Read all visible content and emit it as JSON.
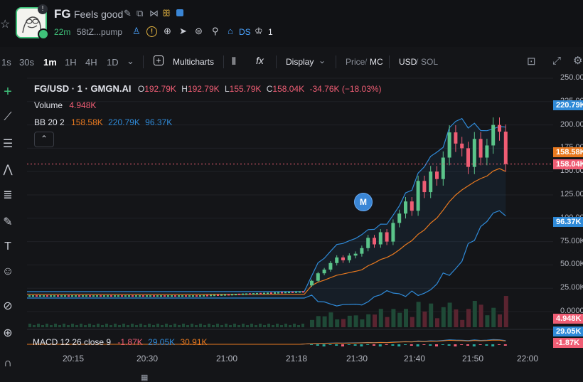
{
  "header": {
    "ticker": "FG",
    "tagline": "Feels good",
    "age": "22m",
    "address": "58tZ...pump",
    "badge": "!",
    "ds_label": "DS",
    "holders_count": "1",
    "icons": [
      "edit-icon",
      "copy-icon",
      "share-icon",
      "people-icon",
      "verified-icon",
      "user-icon",
      "warning-icon",
      "globe-icon",
      "telegram-icon",
      "list-icon",
      "search-icon",
      "dexscreener-icon",
      "crown-icon"
    ],
    "colors": {
      "accent_green": "#3fc27a",
      "accent_blue": "#3a86d6"
    }
  },
  "toolbar": {
    "timeframes": [
      "1s",
      "30s",
      "1m",
      "1H",
      "4H",
      "1D"
    ],
    "active_timeframe": "1m",
    "multicharts_label": "Multicharts",
    "display_label": "Display",
    "price_label": "Price",
    "mc_label": "MC",
    "usd_label": "USD",
    "sol_label": "SOL",
    "fx_label": "fx"
  },
  "chart_meta": {
    "symbol": "FG/USD · 1 · GMGN.AI",
    "open_label": "O",
    "open": "192.79K",
    "high_label": "H",
    "high": "192.79K",
    "low_label": "L",
    "low": "155.79K",
    "close_label": "C",
    "close": "158.04K",
    "change": "-34.76K (−18.03%)",
    "volume_label": "Volume",
    "volume": "4.948K",
    "bb_label": "BB 20 2",
    "bb_basis": "158.58K",
    "bb_upper": "220.79K",
    "bb_lower": "96.37K",
    "macd_label": "MACD 12 26 close 9",
    "macd_hist": "-1.87K",
    "macd_line": "29.05K",
    "macd_signal": "30.91K",
    "marker": "M",
    "price_tags": {
      "upper": "220.79K",
      "basis": "158.58K",
      "last": "158.04K",
      "lower": "96.37K",
      "volume": "4.948K",
      "macd_line": "29.05K",
      "macd_hist": "-1.87K"
    },
    "colors": {
      "up": "#5bc48a",
      "down": "#ef5d74",
      "bb_upper_lower": "#2f8ad8",
      "bb_basis": "#e8791f"
    }
  },
  "chart_data": {
    "type": "candlestick",
    "y_axis_ticks": [
      "250.00K",
      "225.00K",
      "200.00K",
      "175.00K",
      "150.00K",
      "125.00K",
      "100.00K",
      "75.00K",
      "50.00K",
      "25.00K",
      "0.0000"
    ],
    "x_axis_ticks": [
      "20:15",
      "20:30",
      "21:00",
      "21:18",
      "21:30",
      "21:40",
      "21:50",
      "22:00"
    ],
    "ylim": [
      0,
      250000
    ],
    "candles": [
      {
        "t": "21:22",
        "o": 28000,
        "c": 33000
      },
      {
        "t": "21:23",
        "o": 33000,
        "c": 41000
      },
      {
        "t": "21:24",
        "o": 41000,
        "c": 45000
      },
      {
        "t": "21:25",
        "o": 45000,
        "c": 52000
      },
      {
        "t": "21:26",
        "o": 52000,
        "c": 58000
      },
      {
        "t": "21:27",
        "o": 58000,
        "c": 55000
      },
      {
        "t": "21:28",
        "o": 55000,
        "c": 60000
      },
      {
        "t": "21:29",
        "o": 60000,
        "c": 62000
      },
      {
        "t": "21:30",
        "o": 62000,
        "c": 68000
      },
      {
        "t": "21:31",
        "o": 68000,
        "c": 79000
      },
      {
        "t": "21:32",
        "o": 79000,
        "c": 72000
      },
      {
        "t": "21:33",
        "o": 72000,
        "c": 85000
      },
      {
        "t": "21:34",
        "o": 85000,
        "c": 75000
      },
      {
        "t": "21:35",
        "o": 75000,
        "c": 95000
      },
      {
        "t": "21:36",
        "o": 95000,
        "c": 105000
      },
      {
        "t": "21:37",
        "o": 105000,
        "c": 118000
      },
      {
        "t": "21:38",
        "o": 118000,
        "c": 108000
      },
      {
        "t": "21:39",
        "o": 108000,
        "c": 140000
      },
      {
        "t": "21:40",
        "o": 140000,
        "c": 128000
      },
      {
        "t": "21:41",
        "o": 128000,
        "c": 150000
      },
      {
        "t": "21:42",
        "o": 150000,
        "c": 142000
      },
      {
        "t": "21:43",
        "o": 142000,
        "c": 165000
      },
      {
        "t": "21:44",
        "o": 165000,
        "c": 192000
      },
      {
        "t": "21:45",
        "o": 192000,
        "c": 180000
      },
      {
        "t": "21:46",
        "o": 180000,
        "c": 175000
      },
      {
        "t": "21:47",
        "o": 175000,
        "c": 155000
      },
      {
        "t": "21:48",
        "o": 155000,
        "c": 185000
      },
      {
        "t": "21:49",
        "o": 185000,
        "c": 165000
      },
      {
        "t": "21:50",
        "o": 165000,
        "c": 178000
      },
      {
        "t": "21:51",
        "o": 178000,
        "c": 200000
      },
      {
        "t": "21:52",
        "o": 200000,
        "c": 192790
      },
      {
        "t": "21:53",
        "o": 192790,
        "c": 158040
      }
    ]
  }
}
